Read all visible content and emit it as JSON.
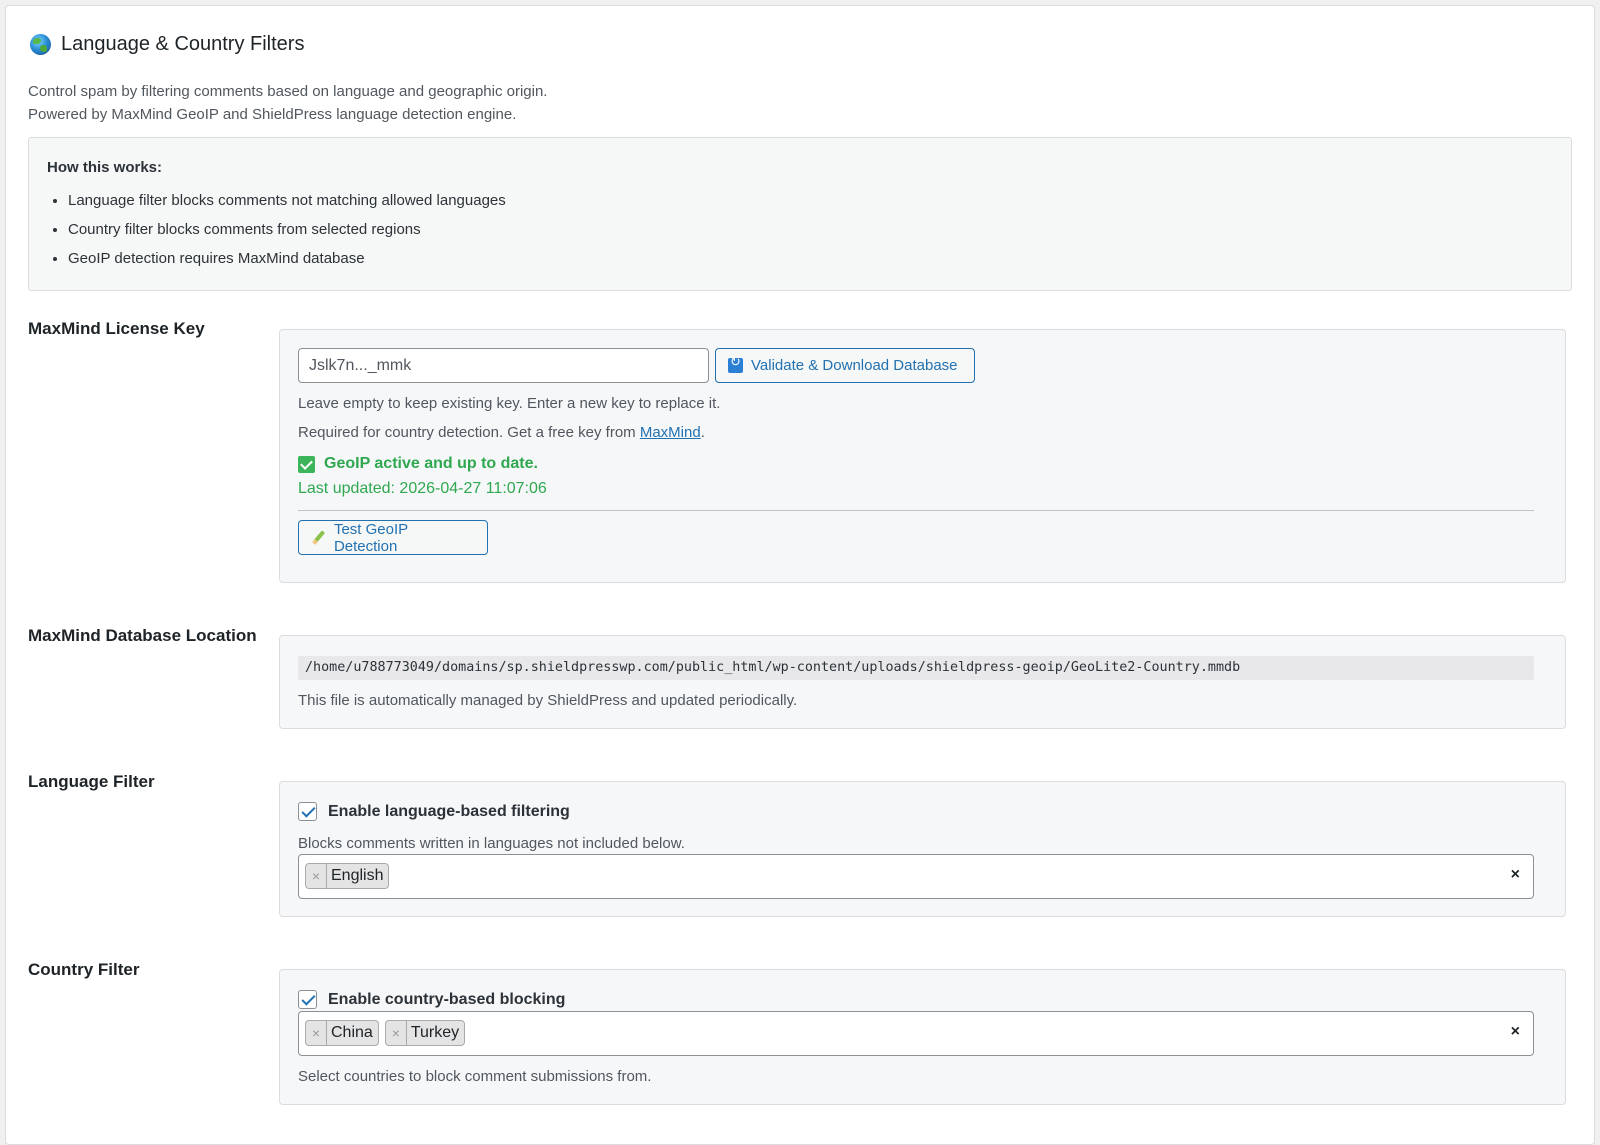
{
  "header": {
    "title": "Language & Country Filters",
    "desc_line1": "Control spam by filtering comments based on language and geographic origin.",
    "desc_line2": "Powered by MaxMind GeoIP and ShieldPress language detection engine."
  },
  "info": {
    "heading": "How this works:",
    "items": [
      "Language filter blocks comments not matching allowed languages",
      "Country filter blocks comments from selected regions",
      "GeoIP detection requires MaxMind database"
    ]
  },
  "license": {
    "label": "MaxMind License Key",
    "input_value": "Jslk7n..._mmk",
    "validate_button": "Validate & Download Database",
    "help1": "Leave empty to keep existing key. Enter a new key to replace it.",
    "help2_prefix": "Required for country detection. Get a free key from ",
    "help2_link": "MaxMind",
    "help2_suffix": ".",
    "status": "GeoIP active and up to date.",
    "last_updated": "Last updated: 2026-04-27 11:07:06",
    "test_button": "Test GeoIP Detection"
  },
  "database": {
    "label": "MaxMind Database Location",
    "path": "/home/u788773049/domains/sp.shieldpresswp.com/public_html/wp-content/uploads/shieldpress-geoip/GeoLite2-Country.mmdb",
    "help": "This file is automatically managed by ShieldPress and updated periodically."
  },
  "language": {
    "label": "Language Filter",
    "checkbox_label": "Enable language-based filtering",
    "checked": true,
    "help": "Blocks comments written in languages not included below.",
    "tags": [
      "English"
    ],
    "clear": "×",
    "remove": "×"
  },
  "country": {
    "label": "Country Filter",
    "checkbox_label": "Enable country-based blocking",
    "checked": true,
    "tags": [
      "China",
      "Turkey"
    ],
    "help": "Select countries to block comment submissions from.",
    "clear": "×",
    "remove": "×"
  }
}
